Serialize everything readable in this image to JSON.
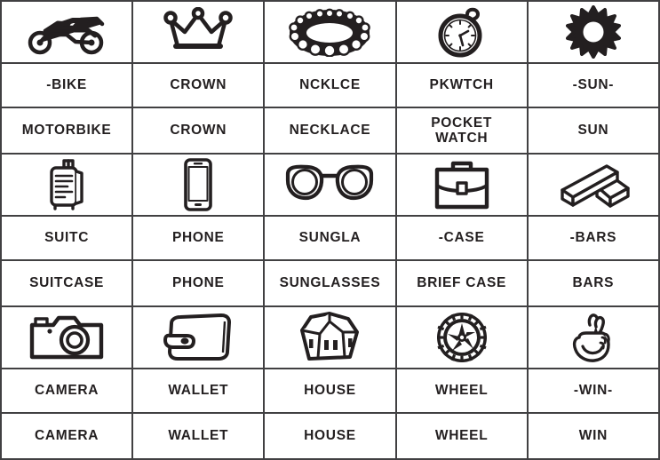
{
  "table": {
    "columns": 5,
    "blocks": [
      {
        "icons": [
          "motorbike-icon",
          "crown-icon",
          "necklace-icon",
          "pocket-watch-icon",
          "sun-icon"
        ],
        "abbreviations": [
          "-BIKE",
          "CROWN",
          "NCKLCE",
          "PKWTCH",
          "-SUN-"
        ],
        "names": [
          "MOTORBIKE",
          "CROWN",
          "NECKLACE",
          "POCKET\nWATCH",
          "SUN"
        ]
      },
      {
        "icons": [
          "suitcase-icon",
          "phone-icon",
          "sunglasses-icon",
          "briefcase-icon",
          "gold-bars-icon"
        ],
        "abbreviations": [
          "SUITC",
          "PHONE",
          "SUNGLA",
          "-CASE",
          "-BARS"
        ],
        "names": [
          "SUITCASE",
          "PHONE",
          "SUNGLASSES",
          "BRIEF CASE",
          "BARS"
        ]
      },
      {
        "icons": [
          "camera-icon",
          "wallet-icon",
          "house-icon",
          "wheel-icon",
          "crossed-fingers-icon"
        ],
        "abbreviations": [
          "CAMERA",
          "WALLET",
          "HOUSE",
          "WHEEL",
          "-WIN-"
        ],
        "names": [
          "CAMERA",
          "WALLET",
          "HOUSE",
          "WHEEL",
          "WIN"
        ]
      }
    ]
  },
  "colors": {
    "ink": "#231f20",
    "border": "#414042",
    "background": "#ffffff"
  }
}
